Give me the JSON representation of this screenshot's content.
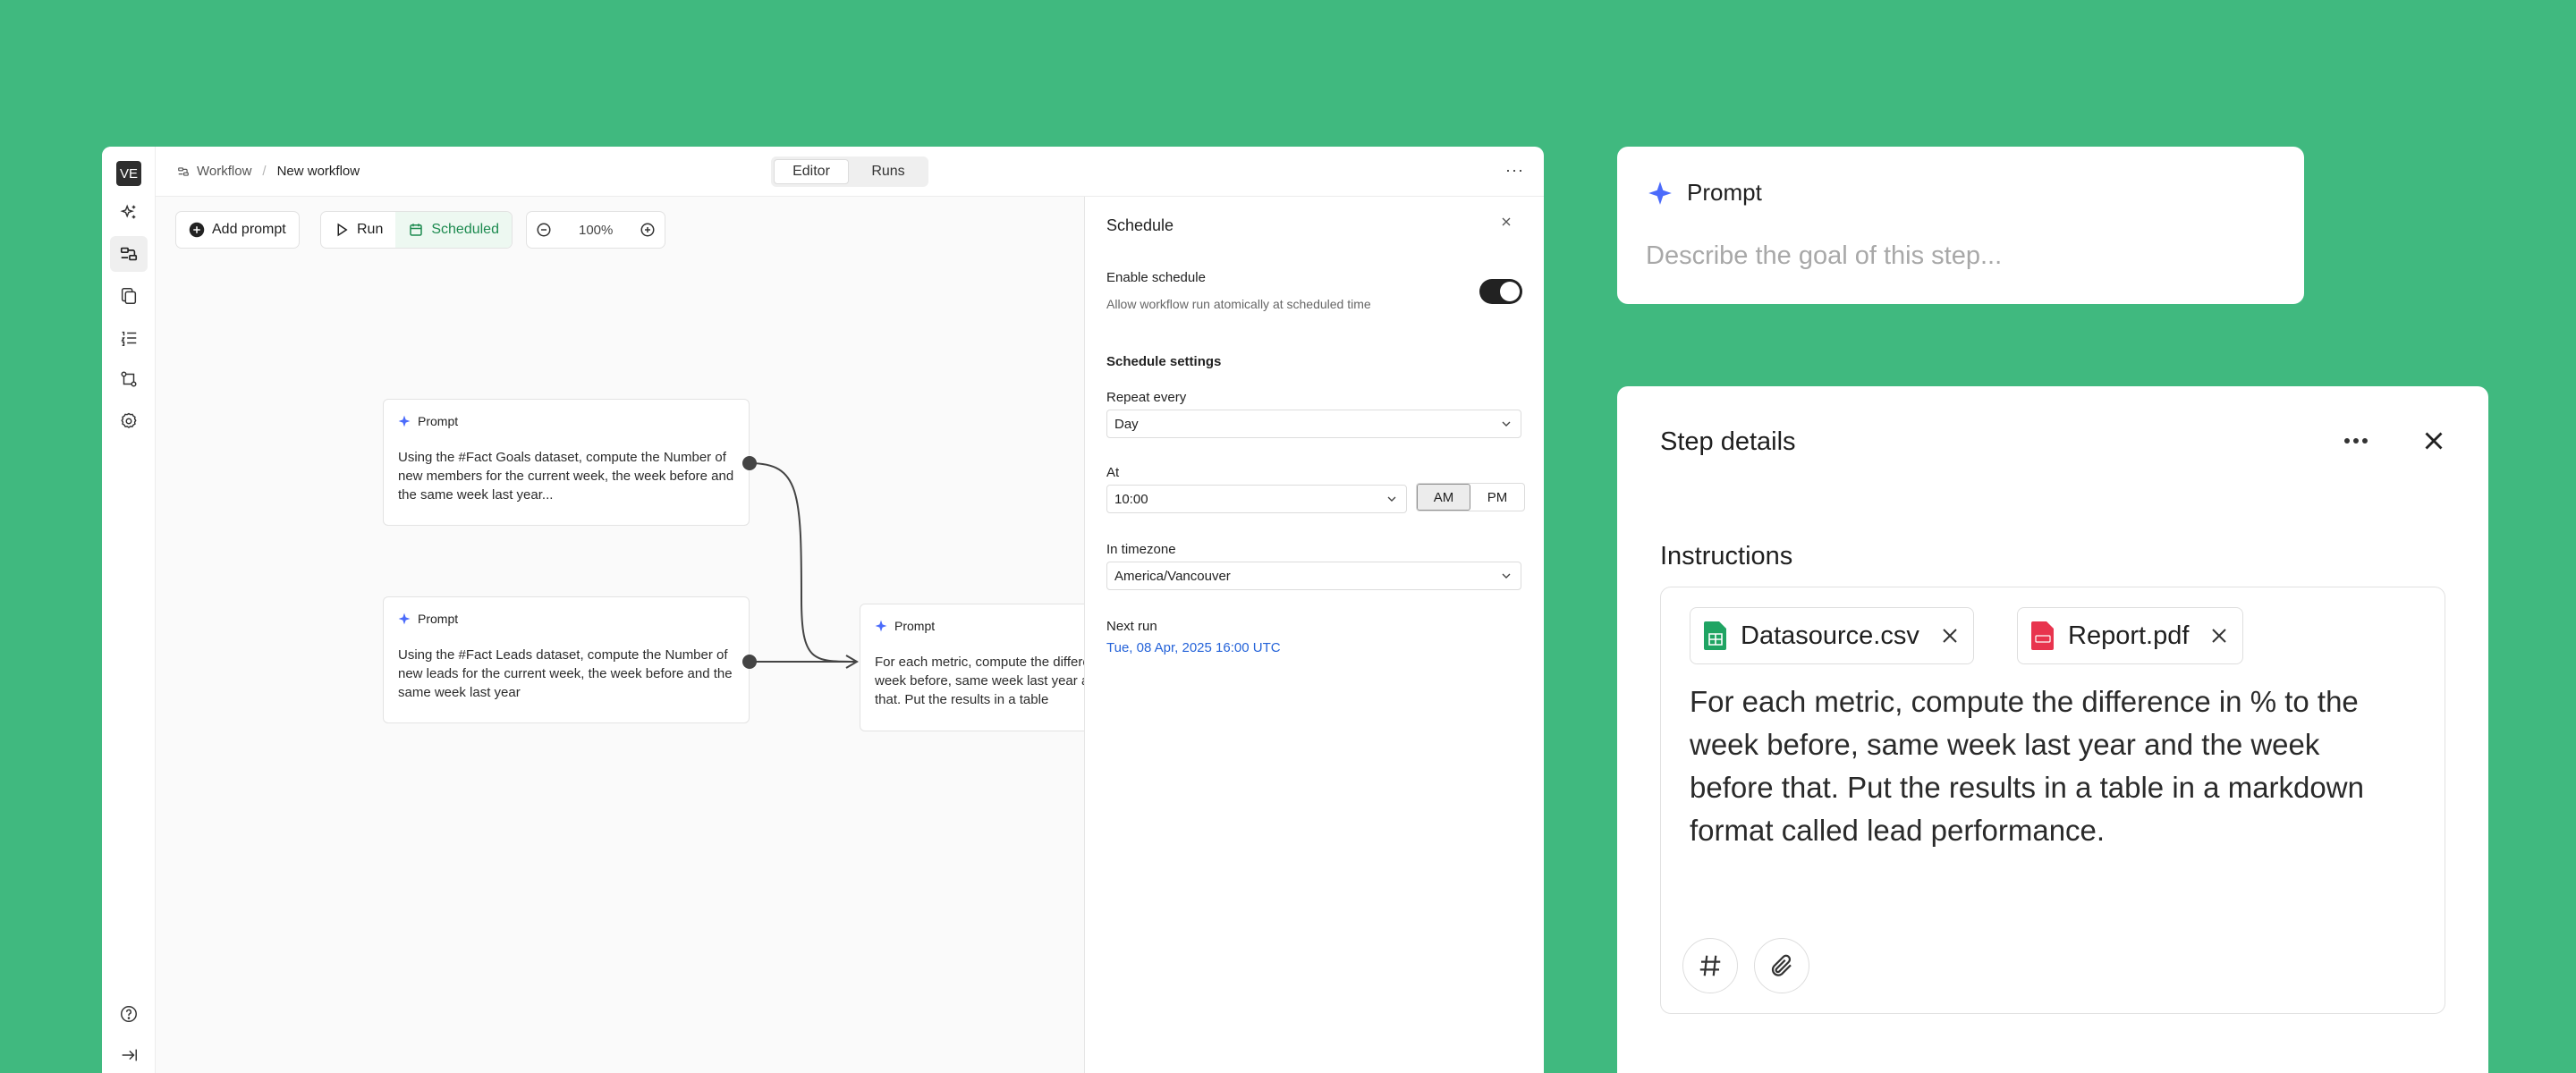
{
  "rail": {
    "avatar": "VE"
  },
  "topbar": {
    "breadcrumb_root": "Workflow",
    "breadcrumb_current": "New workflow",
    "tabs": [
      {
        "label": "Editor",
        "active": true
      },
      {
        "label": "Runs",
        "active": false
      }
    ],
    "more": "···"
  },
  "toolbar": {
    "add_prompt": "Add prompt",
    "run": "Run",
    "scheduled": "Scheduled",
    "zoom": "100%"
  },
  "nodes": [
    {
      "title": "Prompt",
      "text": "Using the #Fact Goals dataset, compute the Number of new members for the current week, the week before and the same week last year..."
    },
    {
      "title": "Prompt",
      "text": "Using the #Fact Leads dataset, compute the Number of new leads for the current week, the week before and the same week last year"
    },
    {
      "title": "Prompt",
      "text": "For each metric, compute the difference in % to the week before, same week last year and the week before that. Put the results in a table"
    }
  ],
  "schedule": {
    "title": "Schedule",
    "enable_label": "Enable schedule",
    "enable_desc": "Allow workflow run atomically at scheduled time",
    "enabled": true,
    "settings_heading": "Schedule settings",
    "repeat_label": "Repeat every",
    "repeat_value": "Day",
    "at_label": "At",
    "at_value": "10:00",
    "am": "AM",
    "pm": "PM",
    "timezone_label": "In timezone",
    "timezone_value": "America/Vancouver",
    "next_run_label": "Next run",
    "next_run_value": "Tue, 08 Apr, 2025 16:00 UTC"
  },
  "prompt_card": {
    "title": "Prompt",
    "placeholder": "Describe the goal of this step..."
  },
  "step_details": {
    "title": "Step details",
    "instructions_label": "Instructions",
    "attachments": [
      {
        "name": "Datasource.csv",
        "type": "sheet"
      },
      {
        "name": "Report.pdf",
        "type": "pdf"
      }
    ],
    "instructions_text": "For each metric, compute the difference in % to the week before, same week last year and the week before that. Put the results in a table in a markdown format called lead performance."
  },
  "colors": {
    "background": "#40b97f",
    "accent_blue": "#2563d9",
    "scheduled_green": "#1c8a4f",
    "sheet_green": "#1fa463",
    "pdf_red": "#e8344e",
    "sparkle_blue": "#4b6bfb"
  }
}
